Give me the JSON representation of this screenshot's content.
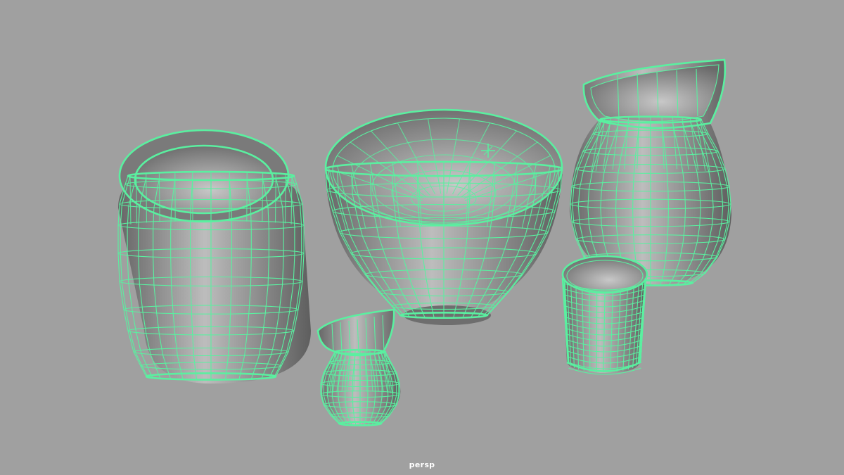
{
  "viewport": {
    "camera": "persp",
    "background_color": "#a0a0a0",
    "wireframe_color": "#5af0a0",
    "shade_light": "#bdbdbd",
    "shade_dark": "#5e5e5e"
  },
  "scene_objects": [
    {
      "name": "jar",
      "icon": "jar-mesh"
    },
    {
      "name": "bowl",
      "icon": "bowl-mesh"
    },
    {
      "name": "pitcher",
      "icon": "pitcher-mesh"
    },
    {
      "name": "small-pitcher",
      "icon": "small-pitcher-mesh"
    },
    {
      "name": "cup",
      "icon": "cup-mesh"
    }
  ],
  "pivot_marker": {
    "icon": "pivot-cross-icon"
  }
}
